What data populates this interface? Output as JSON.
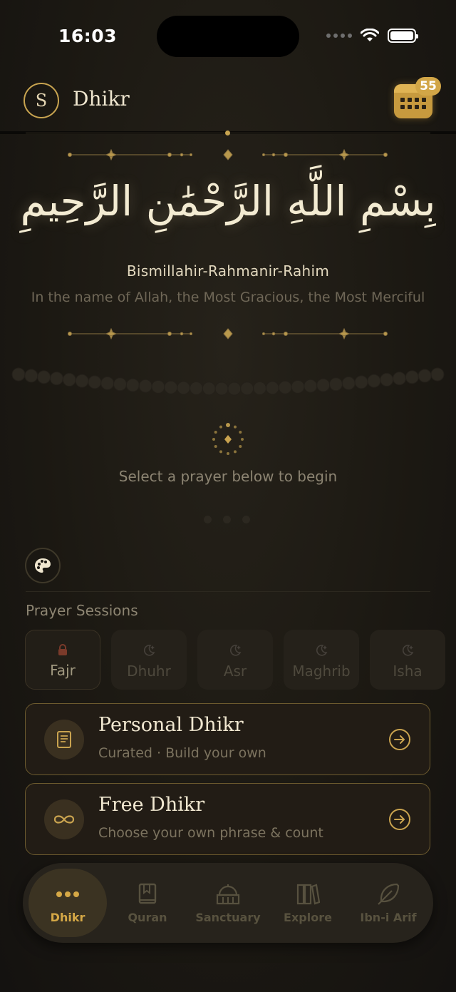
{
  "status": {
    "time": "16:03"
  },
  "header": {
    "avatar_letter": "S",
    "title": "Dhikr",
    "badge_count": "55"
  },
  "verse": {
    "arabic": "بِسْمِ اللَّهِ الرَّحْمَٰنِ الرَّحِيمِ",
    "transliteration": "Bismillahir-Rahmanir-Rahim",
    "translation": "In the name of Allah, the Most Gracious, the Most Merciful"
  },
  "prompt": "Select a prayer below to begin",
  "sessions": {
    "label": "Prayer Sessions",
    "items": [
      {
        "label": "Fajr",
        "icon": "lock-icon"
      },
      {
        "label": "Dhuhr",
        "icon": "moon-star-icon"
      },
      {
        "label": "Asr",
        "icon": "moon-star-icon"
      },
      {
        "label": "Maghrib",
        "icon": "moon-star-icon"
      },
      {
        "label": "Isha",
        "icon": "moon-star-icon"
      }
    ]
  },
  "cards": [
    {
      "title": "Personal Dhikr",
      "subtitle": "Curated · Build your own",
      "icon": "book-icon"
    },
    {
      "title": "Free Dhikr",
      "subtitle": "Choose your own phrase & count",
      "icon": "infinity-icon"
    }
  ],
  "tabs": [
    {
      "label": "Dhikr",
      "icon": "dots-icon"
    },
    {
      "label": "Quran",
      "icon": "book-icon"
    },
    {
      "label": "Sanctuary",
      "icon": "mosque-icon"
    },
    {
      "label": "Explore",
      "icon": "library-icon"
    },
    {
      "label": "Ibn-i Arif",
      "icon": "feather-icon"
    }
  ],
  "colors": {
    "accent": "#d5a846",
    "background": "#1c1913",
    "card_border": "#6c5a2e"
  }
}
